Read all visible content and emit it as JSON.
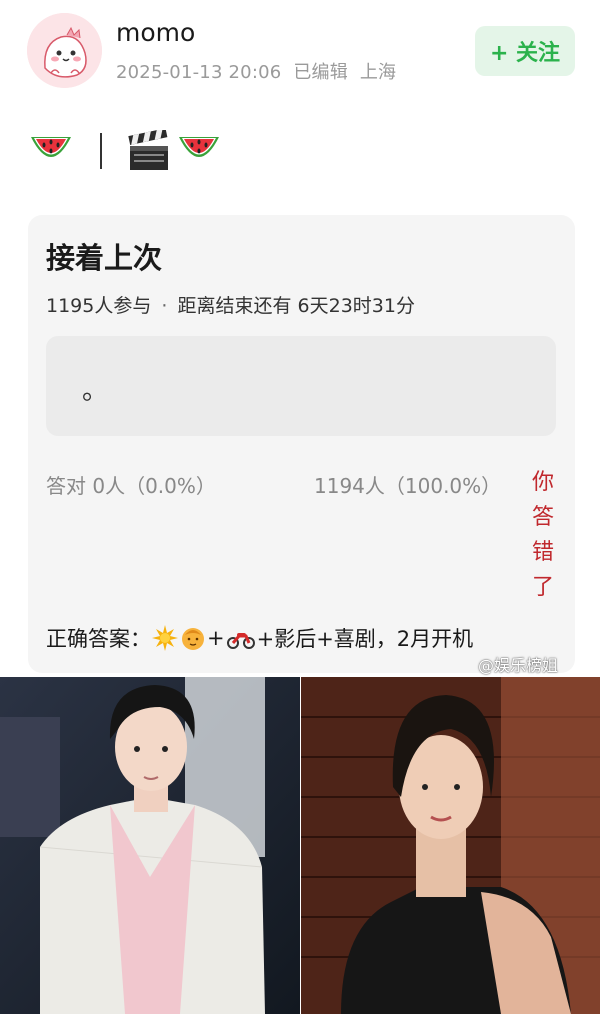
{
  "post": {
    "username": "momo",
    "timestamp": "2025-01-13 20:06",
    "edited": "已编辑",
    "location": "上海",
    "follow_label": "+ 关注",
    "avatar_icon": "cartoon-dino-avatar"
  },
  "emoji_line": {
    "items": [
      "watermelon-icon",
      "separator",
      "clapperboard-icon",
      "watermelon-icon"
    ]
  },
  "poll": {
    "title": "接着上次",
    "participants": "1195人参与",
    "separator": "·",
    "countdown": "距离结束还有 6天23时31分",
    "option_text": "。",
    "correct_stat": "答对  0人（0.0%）",
    "wrong_stat": "1194人（100.0%）",
    "result_badge": "你答错了",
    "answer_label": "正确答案：",
    "answer_text_1": "+",
    "answer_text_2": "+影后+喜剧，2月开机"
  },
  "watermark": "@娱乐榜姐",
  "colors": {
    "follow_bg": "#e4f5e8",
    "follow_text": "#2bb24c",
    "wrong_red": "#c0282d",
    "card_bg": "#f5f5f5"
  }
}
